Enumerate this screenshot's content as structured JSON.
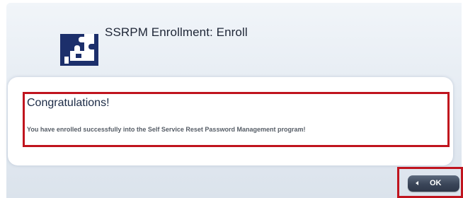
{
  "dialog": {
    "title": "SSRPM Enrollment: Enroll",
    "icon": "ssrpm-puzzle-icon"
  },
  "message": {
    "heading": "Congratulations!",
    "body": "You have enrolled successfully into the Self Service Reset Password Management program!"
  },
  "actions": {
    "ok_label": "OK"
  },
  "colors": {
    "highlight": "#c0141e",
    "button": "#3a4558",
    "background": "#e6ecf3"
  }
}
